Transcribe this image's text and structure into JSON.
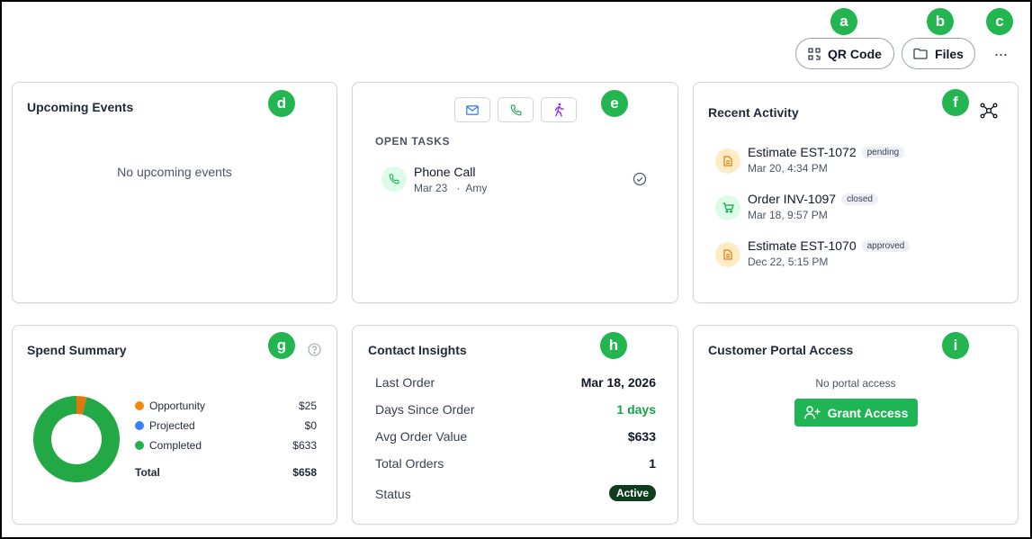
{
  "header": {
    "qr_label": "QR Code",
    "files_label": "Files",
    "more_label": "···"
  },
  "markers": [
    "a",
    "b",
    "c",
    "d",
    "e",
    "f",
    "g",
    "h",
    "i"
  ],
  "upcoming_events": {
    "title": "Upcoming Events",
    "empty_text": "No upcoming events"
  },
  "tasks": {
    "section_label": "OPEN TASKS",
    "items": [
      {
        "name": "Phone Call",
        "meta": "Mar 23   ·  Amy"
      }
    ]
  },
  "recent_activity": {
    "title": "Recent Activity",
    "items": [
      {
        "name": "Estimate EST-1072",
        "status": "pending",
        "date": "Mar 20, 4:34 PM",
        "icon": "document-icon"
      },
      {
        "name": "Order INV-1097",
        "status": "closed",
        "date": "Mar 18, 9:57 PM",
        "icon": "cart-icon"
      },
      {
        "name": "Estimate EST-1070",
        "status": "approved",
        "date": "Dec 22, 5:15 PM",
        "icon": "document-icon"
      }
    ]
  },
  "spend_summary": {
    "title": "Spend Summary",
    "legend": [
      {
        "label": "Opportunity",
        "value": "$25",
        "color": "#f08a0b"
      },
      {
        "label": "Projected",
        "value": "$0",
        "color": "#3b82f6"
      },
      {
        "label": "Completed",
        "value": "$633",
        "color": "#22b14c"
      }
    ],
    "total_label": "Total",
    "total_value": "$658"
  },
  "chart_data": {
    "type": "pie",
    "categories": [
      "Opportunity",
      "Projected",
      "Completed"
    ],
    "values": [
      25,
      0,
      633
    ],
    "colors": [
      "#e3760f",
      "#3b82f6",
      "#22a844"
    ],
    "donut": true
  },
  "contact_insights": {
    "title": "Contact Insights",
    "rows": [
      {
        "label": "Last Order",
        "value": "Mar 18, 2026"
      },
      {
        "label": "Days Since Order",
        "value": "1 days"
      },
      {
        "label": "Avg Order Value",
        "value": "$633"
      },
      {
        "label": "Total Orders",
        "value": "1"
      }
    ],
    "status_label": "Status",
    "status_value": "Active"
  },
  "portal": {
    "title": "Customer Portal Access",
    "empty_text": "No portal access",
    "grant_label": "Grant Access"
  },
  "colors": {
    "accent_green": "#1fb454",
    "marker_green": "#22b550",
    "status_dark": "#0f3d20"
  }
}
